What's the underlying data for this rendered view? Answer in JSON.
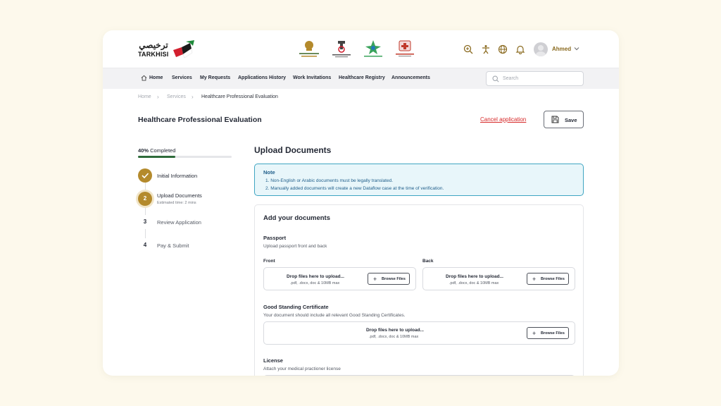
{
  "app": {
    "logo_arabic": "ترخيصي",
    "logo_english": "TARKHISI",
    "emblems": [
      "government-emblem",
      "department-of-health-emblem",
      "abu-dhabi-health-emblem",
      "healthcare-authority-emblem"
    ]
  },
  "header": {
    "icons": [
      "zoom-icon",
      "accessibility-icon",
      "globe-icon",
      "bell-icon"
    ],
    "user_name": "Ahmed"
  },
  "nav": {
    "items": [
      "Home",
      "Services",
      "My Requests",
      "Applications History",
      "Work Invitations",
      "Healthcare Registry",
      "Announcements"
    ],
    "search_placeholder": "Search"
  },
  "breadcrumb": [
    "Home",
    "Services",
    "Healthcare Professional Evaluation"
  ],
  "page": {
    "title": "Healthcare Professional Evaluation",
    "cancel_label": "Cancel application",
    "save_label": "Save"
  },
  "progress": {
    "percent_label": "40%",
    "label_suffix": "Completed",
    "value": 0.4
  },
  "steps": [
    {
      "number": "",
      "label": "Initial Information",
      "sub": "",
      "state": "done"
    },
    {
      "number": "2",
      "label": "Upload Documents",
      "sub": "Estimated time: 2 mins",
      "state": "active"
    },
    {
      "number": "3",
      "label": "Review Application",
      "sub": "",
      "state": "todo"
    },
    {
      "number": "4",
      "label": "Pay & Submit",
      "sub": "",
      "state": "todo"
    }
  ],
  "main": {
    "section_title": "Upload Documents",
    "note": {
      "title": "Note",
      "lines": [
        "1. Non-English or Arabic documents must be legally translated.",
        "2. Manually added documents will create a new Dataflow case at the time of verification."
      ]
    },
    "card_title": "Add your documents",
    "drop_text": "Drop files here to upload...",
    "drop_hint": ".pdf, .docx, doc & 10MB max",
    "browse_label": "Browse Files",
    "groups": {
      "passport": {
        "title": "Passport",
        "sub": "Upload passport front and back",
        "front_label": "Front",
        "back_label": "Back"
      },
      "good_standing": {
        "title": "Good Standing Certificate",
        "sub": "Your document should include all relevant Good Standing Certificates."
      },
      "license": {
        "title": "License",
        "sub": "Attach your medical practioner license"
      }
    }
  },
  "colors": {
    "accent_gold": "#b48a2c",
    "progress_green": "#2e6b3b",
    "danger": "#d62828",
    "note_border": "#3fa5c2",
    "page_bg": "#fdf9ec"
  }
}
